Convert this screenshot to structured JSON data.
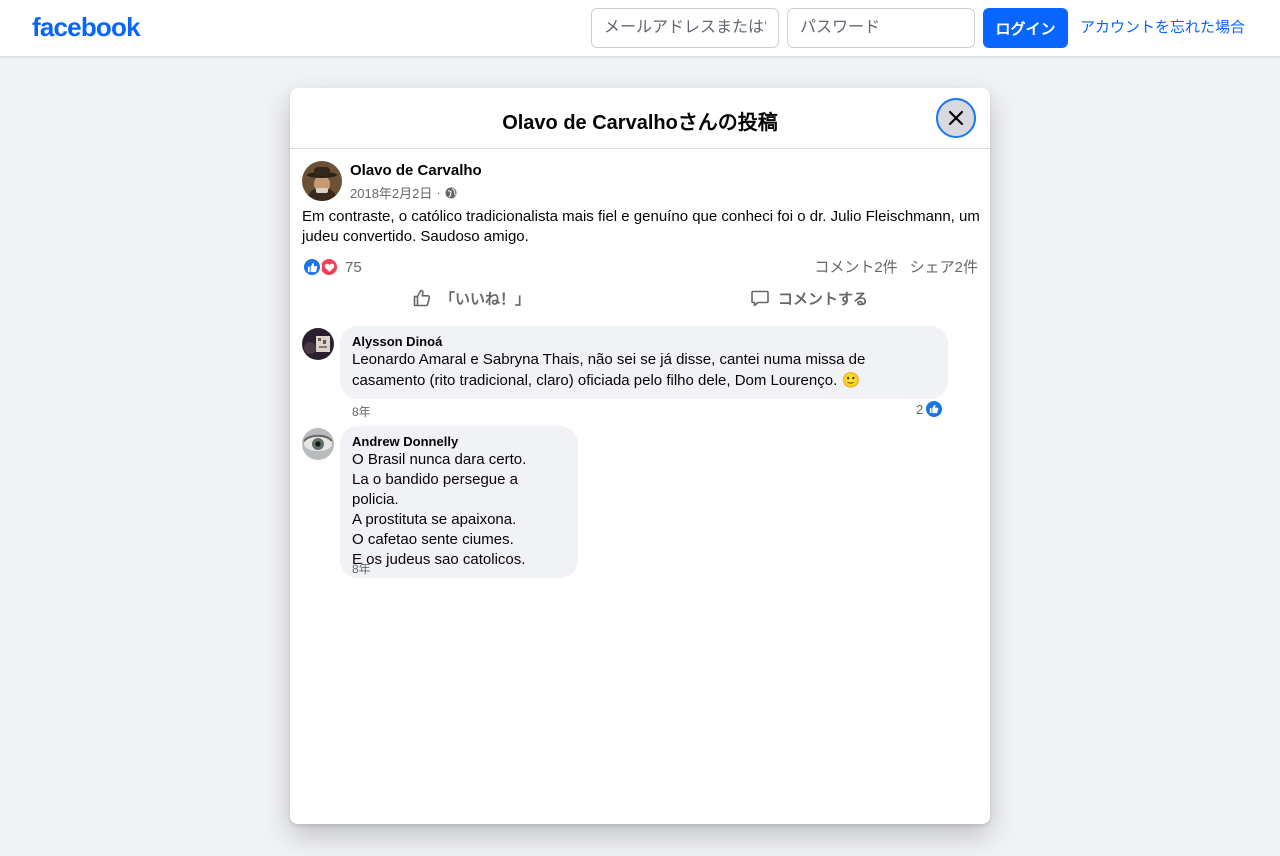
{
  "header": {
    "logo": "facebook",
    "email_placeholder": "メールアドレスまたは電話番号",
    "password_placeholder": "パスワード",
    "login_label": "ログイン",
    "forgot_label": "アカウントを忘れた場合"
  },
  "modal": {
    "title": "Olavo de Carvalhoさんの投稿"
  },
  "post": {
    "author": "Olavo de Carvalho",
    "date": "2018年2月2日",
    "separator": "·",
    "text": "Em contraste, o católico tradicionalista mais fiel e genuíno que conheci foi o dr. Julio Fleischmann, um judeu convertido. Saudoso amigo.",
    "reaction_count": "75",
    "comments_count": "コメント2件",
    "shares_count": "シェア2件",
    "like_label": "「いいね！」",
    "comment_label": "コメントする"
  },
  "comments": [
    {
      "author": "Alysson Dinoá",
      "text": "Leonardo Amaral e Sabryna Thais, não sei se já disse, cantei numa missa de casamento (rito tradicional, claro) oficiada pelo filho dele, Dom Lourenço.",
      "emoji": "🙂",
      "time": "8年",
      "likes": "2"
    },
    {
      "author": "Andrew Donnelly",
      "lines": [
        "O Brasil nunca dara certo.",
        "La o bandido persegue a policia.",
        "A prostituta se apaixona.",
        "O cafetao sente ciumes.",
        "E os judeus sao catolicos."
      ],
      "time": "8年"
    }
  ],
  "colors": {
    "brand": "#0866ff",
    "like": "#1b74e4",
    "love": "#f33e58",
    "background": "#f0f2f5"
  }
}
